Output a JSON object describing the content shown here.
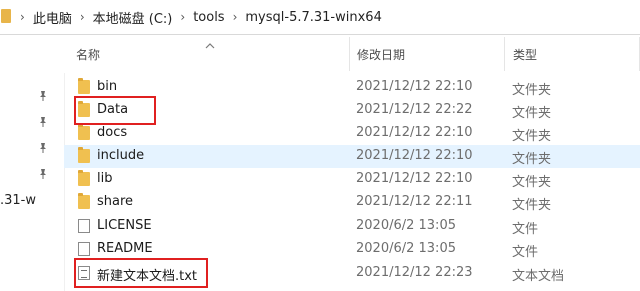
{
  "address_bar": {
    "crumbs": [
      "此电脑",
      "本地磁盘 (C:)",
      "tools",
      "mysql-5.7.31-winx64"
    ],
    "separator": "›"
  },
  "left_pane": {
    "visible_label": ".31-w",
    "pin_count": 4
  },
  "columns": {
    "name": "名称",
    "date": "修改日期",
    "type": "类型",
    "sort_indicator": "up-chevron-icon"
  },
  "files": [
    {
      "name": "bin",
      "date": "2021/12/12 22:10",
      "type": "文件夹",
      "icon": "folder-icon"
    },
    {
      "name": "Data",
      "date": "2021/12/12 22:22",
      "type": "文件夹",
      "icon": "folder-icon"
    },
    {
      "name": "docs",
      "date": "2021/12/12 22:10",
      "type": "文件夹",
      "icon": "folder-icon"
    },
    {
      "name": "include",
      "date": "2021/12/12 22:10",
      "type": "文件夹",
      "icon": "folder-icon"
    },
    {
      "name": "lib",
      "date": "2021/12/12 22:10",
      "type": "文件夹",
      "icon": "folder-icon"
    },
    {
      "name": "share",
      "date": "2021/12/12 22:11",
      "type": "文件夹",
      "icon": "folder-icon"
    },
    {
      "name": "LICENSE",
      "date": "2020/6/2 13:05",
      "type": "文件",
      "icon": "file-icon"
    },
    {
      "name": "README",
      "date": "2020/6/2 13:05",
      "type": "文件",
      "icon": "file-icon"
    },
    {
      "name": "新建文本文档.txt",
      "date": "2021/12/12 22:23",
      "type": "文本文档",
      "icon": "text-document-icon"
    }
  ],
  "colors": {
    "hover_row": "#e5f3ff",
    "highlight_box": "#e02020",
    "folder": "#f0c050"
  }
}
